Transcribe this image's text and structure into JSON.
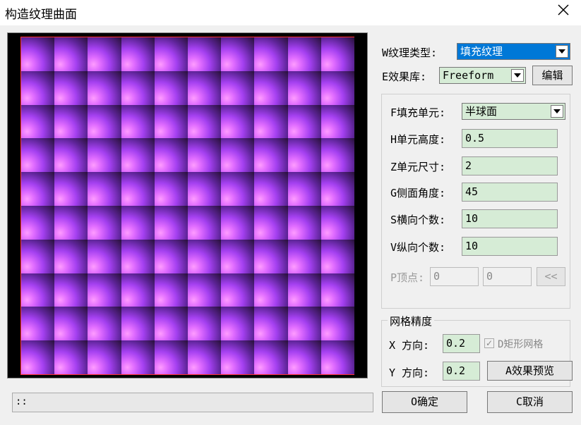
{
  "window": {
    "title": "构造纹理曲面",
    "close_icon": "close-icon"
  },
  "texture_type": {
    "label": "W纹理类型:",
    "value": "填充纹理"
  },
  "effect_library": {
    "label": "E效果库:",
    "value": "Freeform",
    "edit_button": "编辑"
  },
  "fill": {
    "unit_label": "F填充单元:",
    "unit_value": "半球面",
    "height_label": "H单元高度:",
    "height_value": "0.5",
    "size_label": "Z单元尺寸:",
    "size_value": "2",
    "angle_label": "G侧面角度:",
    "angle_value": "45",
    "horizontal_label": "S横向个数:",
    "horizontal_value": "10",
    "vertical_label": "V纵向个数:",
    "vertical_value": "10",
    "vertex_label": "P顶点:",
    "vertex_x": "0",
    "vertex_y": "0",
    "vertex_button": "<<"
  },
  "mesh": {
    "title": "网格精度",
    "x_label": "X 方向:",
    "x_value": "0.2",
    "y_label": "Y 方向:",
    "y_value": "0.2",
    "rect_mesh_label": "D矩形网格",
    "rect_mesh_checked": true,
    "preview_button": "A效果预览"
  },
  "status_text": "::",
  "ok_button": "O确定",
  "cancel_button": "C取消",
  "preview": {
    "rows": 10,
    "cols": 10,
    "tile_colors": [
      "#ff9cff",
      "#e06cff",
      "#a440f0",
      "#5d2497",
      "#271038"
    ]
  }
}
